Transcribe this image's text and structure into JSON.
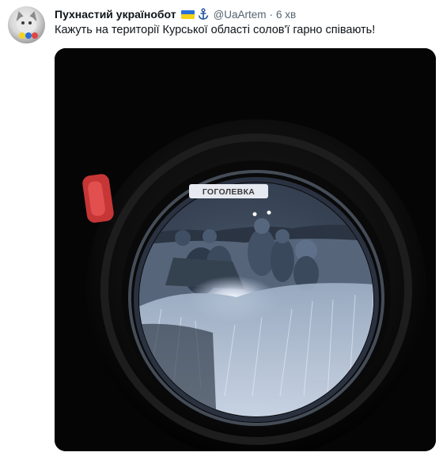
{
  "tweet": {
    "display_name": "Пухнастий українобот",
    "handle": "@UaArtem",
    "separator": "·",
    "time": "6 хв",
    "text": "Кажуть на території Курської області солов'ї гарно співають!",
    "badges": [
      "ukraine-flag-icon",
      "anchor-icon"
    ]
  },
  "media": {
    "sign_text": "ГОГОЛЕВКА",
    "colors": {
      "scope_body": "#0b0b0b",
      "night_vision_tint": "#c9d6e8",
      "red_light": "#d43a3a",
      "link_blue": "#1d9bf0"
    }
  }
}
